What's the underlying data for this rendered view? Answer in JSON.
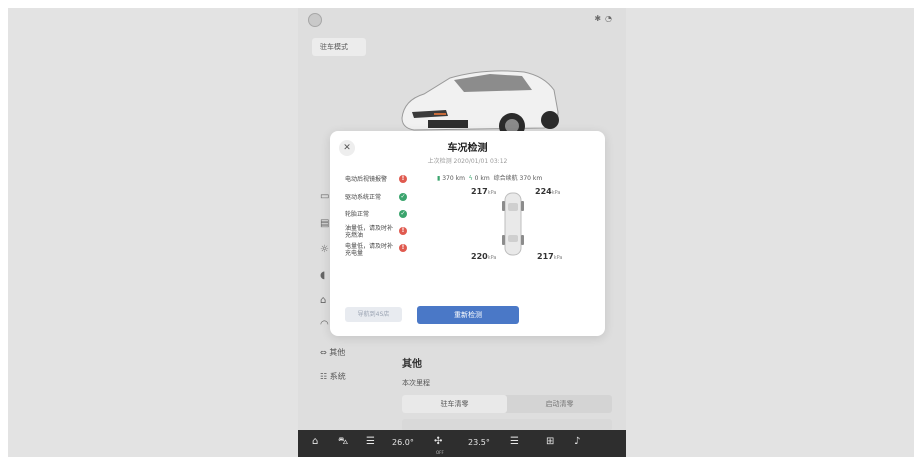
{
  "screen": {
    "mode_button": "驻车模式",
    "sidebar": [
      {
        "label": "其他",
        "icon": "car-link-icon"
      },
      {
        "label": "系统",
        "icon": "sliders-icon"
      }
    ],
    "section": {
      "title": "其他",
      "sublabel": "本次里程"
    },
    "segmented": {
      "left": "驻车清零",
      "right": "启动清零"
    },
    "bottom_bar": {
      "temp_left": "26.0°",
      "temp_right": "23.5°",
      "fan_label": "OFF"
    }
  },
  "dialog": {
    "title": "车况检测",
    "last_check": "上次检测 2020/01/01 03:12",
    "checks": [
      {
        "label": "电动后视镜报警",
        "status": "error"
      },
      {
        "label": "驱动系统正常",
        "status": "ok"
      },
      {
        "label": "轮胎正常",
        "status": "ok"
      },
      {
        "label": "油量低，请及时补充燃油",
        "status": "error"
      },
      {
        "label": "电量低，请及时补充电量",
        "status": "error"
      }
    ],
    "range": {
      "fuel_value": "370",
      "fuel_unit": "km",
      "electric_value": "0",
      "electric_unit": "km",
      "combined_label": "综合续航",
      "combined_value": "370",
      "combined_unit": "km"
    },
    "tires": {
      "front_left": "217",
      "front_right": "224",
      "rear_left": "220",
      "rear_right": "217",
      "unit": "kPa"
    },
    "buttons": {
      "secondary": "导航到4S店",
      "primary": "重新检测"
    }
  },
  "colors": {
    "primary_button": "#4a78c7",
    "error": "#e05a4f",
    "ok": "#3aa46d"
  }
}
